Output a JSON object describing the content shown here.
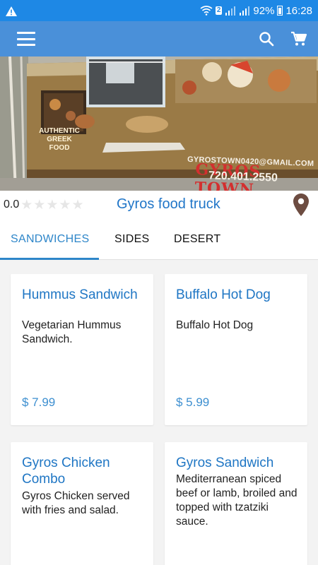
{
  "status_bar": {
    "sim_badge": "2",
    "battery": "92%",
    "time": "16:28"
  },
  "app_bar": {
    "menu_icon": "hamburger-menu-icon",
    "search_icon": "search-icon",
    "cart_icon": "shopping-cart-icon"
  },
  "hero": {
    "sign_title": "GYROS TOWN",
    "sign_email": "GYROSTOWN0420@GMAIL.COM",
    "sign_phone": "720.401.2550",
    "sign_tagline": "AUTHENTIC GREEK FOOD"
  },
  "truck": {
    "rating": "0.0",
    "stars_filled": 0,
    "stars_total": 5,
    "name": "Gyros food truck",
    "location_icon": "map-pin-icon"
  },
  "tabs": [
    {
      "label": "SANDWICHES",
      "active": true
    },
    {
      "label": "SIDES",
      "active": false
    },
    {
      "label": "DESERT",
      "active": false
    }
  ],
  "items": [
    {
      "title": "Hummus Sandwich",
      "description": "Vegetarian Hummus Sandwich.",
      "price": "$ 7.99"
    },
    {
      "title": "Buffalo Hot Dog",
      "description": "Buffalo Hot Dog",
      "price": "$ 5.99"
    },
    {
      "title": "Gyros Chicken Combo",
      "description": "Gyros Chicken served with fries and salad.",
      "price": ""
    },
    {
      "title": "Gyros Sandwich",
      "description": "Mediterranean spiced beef or lamb, broiled and topped with tzatziki sauce.",
      "price": ""
    }
  ],
  "colors": {
    "status_bar": "#1e88e5",
    "app_bar": "#4a90d9",
    "accent": "#2e86c9",
    "item_title": "#1f76c4",
    "pin": "#6d4c41"
  }
}
